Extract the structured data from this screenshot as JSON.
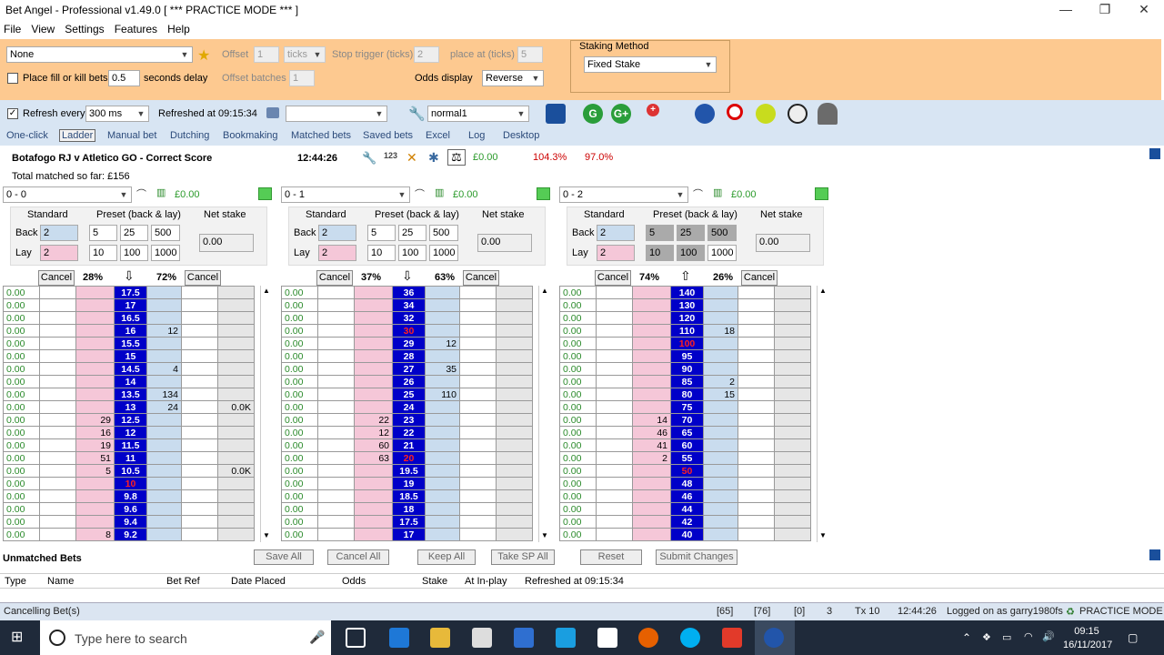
{
  "app": {
    "title": "Bet Angel - Professional v1.49.0 [ *** PRACTICE MODE *** ]"
  },
  "menu": [
    "File",
    "View",
    "Settings",
    "Features",
    "Help"
  ],
  "toolbar": {
    "profile": "None",
    "offset_label": "Offset",
    "offset_value": "1",
    "ticks_value": "ticks",
    "stop_trigger_label": "Stop trigger (ticks)",
    "stop_trigger_value": "2",
    "place_at_label": "place at (ticks)",
    "place_at_value": "5",
    "fill_kill_label": "Place fill or kill bets",
    "fill_kill_value": "0.5",
    "seconds_delay_label": "seconds delay",
    "offset_batches_label": "Offset batches",
    "offset_batches_value": "1",
    "odds_display_label": "Odds display",
    "odds_display_value": "Reverse",
    "staking_method_label": "Staking Method",
    "staking_method_value": "Fixed Stake"
  },
  "refresh": {
    "label": "Refresh every",
    "value": "300 ms",
    "refreshed_at": "Refreshed at 09:15:34",
    "profile": "normal1"
  },
  "tabs": [
    "One-click",
    "Ladder",
    "Manual bet",
    "Dutching",
    "Bookmaking",
    "Matched bets",
    "Saved bets",
    "Excel",
    "Log",
    "Desktop"
  ],
  "market": {
    "name": "Botafogo RJ v Atletico GO - Correct Score",
    "time": "12:44:26",
    "total_matched": "Total matched so far: £156",
    "pl": "£0.00",
    "back_book": "104.3%",
    "lay_book": "97.0%"
  },
  "panel_labels": {
    "standard": "Standard",
    "preset": "Preset (back & lay)",
    "net_stake": "Net stake",
    "back": "Back",
    "lay": "Lay",
    "cancel": "Cancel"
  },
  "runners": [
    {
      "name": "0 - 0",
      "pl": "£0.00",
      "back_std": "2",
      "lay_std": "2",
      "preset_back": [
        "5",
        "25",
        "500"
      ],
      "preset_lay": [
        "10",
        "100",
        "1000"
      ],
      "net": "0.00",
      "pct_left": "28%",
      "pct_right": "72%",
      "arrow": "⇩",
      "rows": [
        [
          "0.00",
          "",
          "",
          "17.5",
          "",
          "",
          ""
        ],
        [
          "0.00",
          "",
          "",
          "17",
          "",
          "",
          ""
        ],
        [
          "0.00",
          "",
          "",
          "16.5",
          "",
          "",
          ""
        ],
        [
          "0.00",
          "",
          "",
          "16",
          "12",
          "",
          ""
        ],
        [
          "0.00",
          "",
          "",
          "15.5",
          "",
          "",
          ""
        ],
        [
          "0.00",
          "",
          "",
          "15",
          "",
          "",
          ""
        ],
        [
          "0.00",
          "",
          "",
          "14.5",
          "4",
          "",
          ""
        ],
        [
          "0.00",
          "",
          "",
          "14",
          "",
          "",
          ""
        ],
        [
          "0.00",
          "",
          "",
          "13.5",
          "134",
          "",
          ""
        ],
        [
          "0.00",
          "",
          "",
          "13",
          "24",
          "",
          "0.0K"
        ],
        [
          "0.00",
          "",
          "29",
          "12.5",
          "",
          "",
          ""
        ],
        [
          "0.00",
          "",
          "16",
          "12",
          "",
          "",
          ""
        ],
        [
          "0.00",
          "",
          "19",
          "11.5",
          "",
          "",
          ""
        ],
        [
          "0.00",
          "",
          "51",
          "11",
          "",
          "",
          ""
        ],
        [
          "0.00",
          "",
          "5",
          "10.5",
          "",
          "",
          "0.0K"
        ],
        [
          "0.00",
          "",
          "",
          "10",
          "",
          "",
          ""
        ],
        [
          "0.00",
          "",
          "",
          "9.8",
          "",
          "",
          ""
        ],
        [
          "0.00",
          "",
          "",
          "9.6",
          "",
          "",
          ""
        ],
        [
          "0.00",
          "",
          "",
          "9.4",
          "",
          "",
          ""
        ],
        [
          "0.00",
          "",
          "8",
          "9.2",
          "",
          "",
          ""
        ]
      ],
      "red_index": 15
    },
    {
      "name": "0 - 1",
      "pl": "£0.00",
      "back_std": "2",
      "lay_std": "2",
      "preset_back": [
        "5",
        "25",
        "500"
      ],
      "preset_lay": [
        "10",
        "100",
        "1000"
      ],
      "net": "0.00",
      "pct_left": "37%",
      "pct_right": "63%",
      "arrow": "⇩",
      "rows": [
        [
          "0.00",
          "",
          "",
          "36",
          "",
          "",
          ""
        ],
        [
          "0.00",
          "",
          "",
          "34",
          "",
          "",
          ""
        ],
        [
          "0.00",
          "",
          "",
          "32",
          "",
          "",
          ""
        ],
        [
          "0.00",
          "",
          "",
          "30",
          "",
          "",
          ""
        ],
        [
          "0.00",
          "",
          "",
          "29",
          "12",
          "",
          ""
        ],
        [
          "0.00",
          "",
          "",
          "28",
          "",
          "",
          ""
        ],
        [
          "0.00",
          "",
          "",
          "27",
          "35",
          "",
          ""
        ],
        [
          "0.00",
          "",
          "",
          "26",
          "",
          "",
          ""
        ],
        [
          "0.00",
          "",
          "",
          "25",
          "110",
          "",
          ""
        ],
        [
          "0.00",
          "",
          "",
          "24",
          "",
          "",
          ""
        ],
        [
          "0.00",
          "",
          "22",
          "23",
          "",
          "",
          ""
        ],
        [
          "0.00",
          "",
          "12",
          "22",
          "",
          "",
          ""
        ],
        [
          "0.00",
          "",
          "60",
          "21",
          "",
          "",
          ""
        ],
        [
          "0.00",
          "",
          "63",
          "20",
          "",
          "",
          ""
        ],
        [
          "0.00",
          "",
          "",
          "19.5",
          "",
          "",
          ""
        ],
        [
          "0.00",
          "",
          "",
          "19",
          "",
          "",
          ""
        ],
        [
          "0.00",
          "",
          "",
          "18.5",
          "",
          "",
          ""
        ],
        [
          "0.00",
          "",
          "",
          "18",
          "",
          "",
          ""
        ],
        [
          "0.00",
          "",
          "",
          "17.5",
          "",
          "",
          ""
        ],
        [
          "0.00",
          "",
          "",
          "17",
          "",
          "",
          ""
        ]
      ],
      "red_index": 3,
      "red_index2": 13
    },
    {
      "name": "0 - 2",
      "pl": "£0.00",
      "back_std": "2",
      "lay_std": "2",
      "preset_back": [
        "5",
        "25",
        "500"
      ],
      "preset_lay": [
        "10",
        "100",
        "1000"
      ],
      "net": "0.00",
      "pct_left": "74%",
      "pct_right": "26%",
      "arrow": "⇧",
      "rows": [
        [
          "0.00",
          "",
          "",
          "140",
          "",
          "",
          ""
        ],
        [
          "0.00",
          "",
          "",
          "130",
          "",
          "",
          ""
        ],
        [
          "0.00",
          "",
          "",
          "120",
          "",
          "",
          ""
        ],
        [
          "0.00",
          "",
          "",
          "110",
          "18",
          "",
          ""
        ],
        [
          "0.00",
          "",
          "",
          "100",
          "",
          "",
          ""
        ],
        [
          "0.00",
          "",
          "",
          "95",
          "",
          "",
          ""
        ],
        [
          "0.00",
          "",
          "",
          "90",
          "",
          "",
          ""
        ],
        [
          "0.00",
          "",
          "",
          "85",
          "2",
          "",
          ""
        ],
        [
          "0.00",
          "",
          "",
          "80",
          "15",
          "",
          ""
        ],
        [
          "0.00",
          "",
          "",
          "75",
          "",
          "",
          ""
        ],
        [
          "0.00",
          "",
          "14",
          "70",
          "",
          "",
          ""
        ],
        [
          "0.00",
          "",
          "46",
          "65",
          "",
          "",
          ""
        ],
        [
          "0.00",
          "",
          "41",
          "60",
          "",
          "",
          ""
        ],
        [
          "0.00",
          "",
          "2",
          "55",
          "",
          "",
          ""
        ],
        [
          "0.00",
          "",
          "",
          "50",
          "",
          "",
          ""
        ],
        [
          "0.00",
          "",
          "",
          "48",
          "",
          "",
          ""
        ],
        [
          "0.00",
          "",
          "",
          "46",
          "",
          "",
          ""
        ],
        [
          "0.00",
          "",
          "",
          "44",
          "",
          "",
          ""
        ],
        [
          "0.00",
          "",
          "",
          "42",
          "",
          "",
          ""
        ],
        [
          "0.00",
          "",
          "",
          "40",
          "",
          "",
          ""
        ]
      ],
      "red_index": 4,
      "red_index2": 14
    }
  ],
  "unmatched": {
    "title": "Unmatched Bets",
    "buttons": [
      "Save All",
      "Cancel All",
      "Keep All",
      "Take SP All",
      "Reset",
      "Submit Changes"
    ],
    "columns": [
      "Type",
      "Name",
      "Bet Ref",
      "Date Placed",
      "Odds",
      "Stake",
      "At In-play",
      "Refreshed at 09:15:34"
    ]
  },
  "status": {
    "left": "Cancelling Bet(s)",
    "c1": "[65]",
    "c2": "[76]",
    "c3": "[0]",
    "c4": "3",
    "c5": "Tx 10",
    "time": "12:44:26",
    "user": "Logged on as garry1980fs",
    "mode": "PRACTICE MODE"
  },
  "taskbar": {
    "search": "Type here to search",
    "time": "09:15",
    "date": "16/11/2017"
  }
}
